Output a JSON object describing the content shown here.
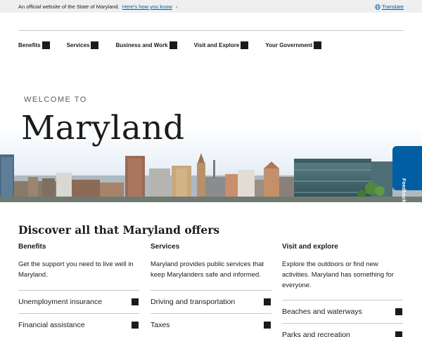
{
  "banner": {
    "official_text": "An official website of the State of Maryland.",
    "how_know_link": "Here's how you know",
    "translate_link": "Translate"
  },
  "nav": {
    "items": [
      {
        "label": "Benefits"
      },
      {
        "label": "Services"
      },
      {
        "label": "Business and Work"
      },
      {
        "label": "Visit and Explore"
      },
      {
        "label": "Your Government"
      }
    ]
  },
  "hero": {
    "eyebrow": "WELCOME TO",
    "title": "Maryland"
  },
  "feedback": {
    "label": "Feedback"
  },
  "discover": {
    "title": "Discover all that Maryland offers",
    "columns": [
      {
        "heading": "Benefits",
        "description": "Get the support you need to live well in Maryland.",
        "links": [
          "Unemployment insurance",
          "Financial assistance"
        ]
      },
      {
        "heading": "Services",
        "description": "Maryland provides public services that keep Marylanders safe and informed.",
        "links": [
          "Driving and transportation",
          "Taxes"
        ]
      },
      {
        "heading": "Visit and explore",
        "description": "Explore the outdoors or find new activities. Maryland has something for everyone.",
        "links": [
          "Beaches and waterways",
          "Parks and recreation"
        ]
      }
    ]
  },
  "colors": {
    "link_blue": "#005ea2",
    "banner_bg": "#efefef",
    "text": "#1b1b1b"
  }
}
